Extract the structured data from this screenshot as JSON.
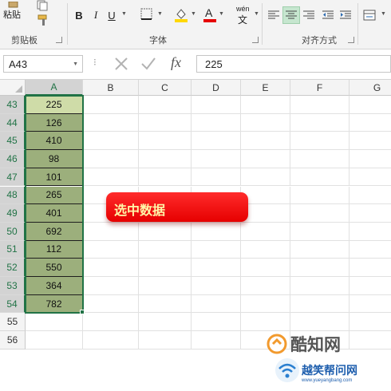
{
  "ribbon": {
    "clipboard": {
      "paste_label": "粘贴",
      "group_label": "剪贴板"
    },
    "font": {
      "bold": "B",
      "italic": "I",
      "underline": "U",
      "wen_top": "wén",
      "wen_bottom": "文",
      "font_color_glyph": "A",
      "group_label": "字体"
    },
    "alignment": {
      "group_label": "对齐方式"
    }
  },
  "formula_bar": {
    "name_box": "A43",
    "fx_label": "fx",
    "value": "225"
  },
  "columns": [
    "A",
    "B",
    "C",
    "D",
    "E",
    "F",
    "G"
  ],
  "rows": [
    "43",
    "44",
    "45",
    "46",
    "47",
    "48",
    "49",
    "50",
    "51",
    "52",
    "53",
    "54",
    "55",
    "56"
  ],
  "column_a_values": [
    "225",
    "126",
    "410",
    "98",
    "101",
    "265",
    "401",
    "692",
    "112",
    "550",
    "364",
    "782"
  ],
  "callout": {
    "text": "选中数据"
  },
  "watermark": {
    "site1": "酷知网",
    "site2": "越笑帮问网",
    "site2_url": "www.yueyangbang.com"
  },
  "colors": {
    "accent": "#217346",
    "selection_fill": "#9caf7c",
    "callout": "#ff0000"
  }
}
